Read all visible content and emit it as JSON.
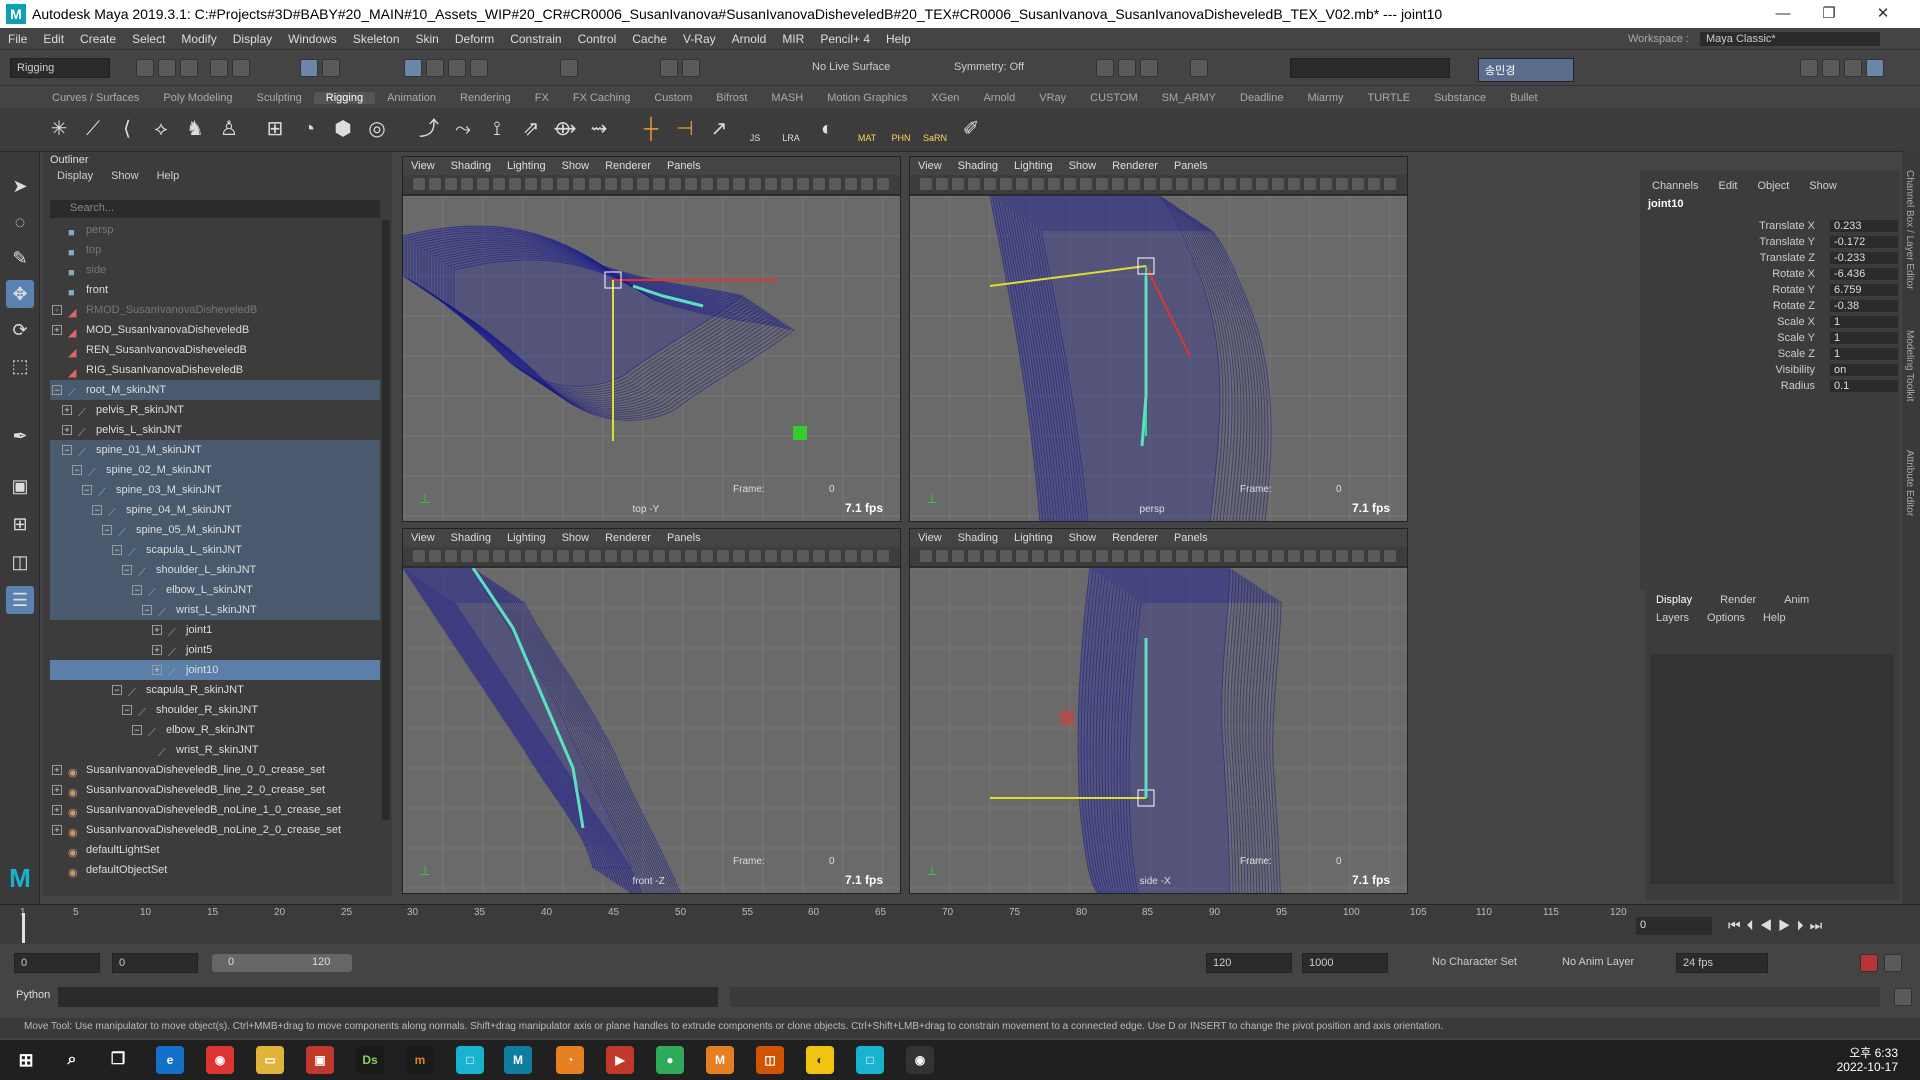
{
  "window": {
    "title": "Autodesk Maya 2019.3.1: C:#Projects#3D#BABY#20_MAIN#10_Assets_WIP#20_CR#CR0006_SusanIvanova#SusanIvanovaDisheveledB#20_TEX#CR0006_SusanIvanova_SusanIvanovaDisheveledB_TEX_V02.mb*  ---  joint10",
    "minimize": "—",
    "maximize": "❐",
    "close": "✕",
    "logo": "M"
  },
  "menubar": [
    "File",
    "Edit",
    "Create",
    "Select",
    "Modify",
    "Display",
    "Windows",
    "Skeleton",
    "Skin",
    "Deform",
    "Constrain",
    "Control",
    "Cache",
    "V-Ray",
    "Arnold",
    "MIR",
    "Pencil+ 4",
    "Help"
  ],
  "workspace": {
    "label": "Workspace :",
    "value": "Maya Classic*"
  },
  "statusline": {
    "menuset": "Rigging",
    "live_surface": "No Live Surface",
    "symmetry": "Symmetry: Off",
    "user": "송민경"
  },
  "shelf_tabs": [
    "Curves / Surfaces",
    "Poly Modeling",
    "Sculpting",
    "Rigging",
    "Animation",
    "Rendering",
    "FX",
    "FX Caching",
    "Custom",
    "Bifrost",
    "MASH",
    "Motion Graphics",
    "XGen",
    "Arnold",
    "VRay",
    "CUSTOM",
    "SM_ARMY",
    "Deadline",
    "Miarmy",
    "TURTLE",
    "Substance",
    "Bullet"
  ],
  "shelf_active": "Rigging",
  "shelf_labels": {
    "js": "JS",
    "lra": "LRA",
    "mat": "MAT",
    "phn": "PHN",
    "sarn": "SaRN"
  },
  "outliner": {
    "title": "Outliner",
    "menu": [
      "Display",
      "Show",
      "Help"
    ],
    "search_placeholder": "Search...",
    "items": [
      {
        "label": "persp",
        "indent": 0,
        "state": "dim",
        "icon": "camera"
      },
      {
        "label": "top",
        "indent": 0,
        "state": "dim",
        "icon": "camera"
      },
      {
        "label": "side",
        "indent": 0,
        "state": "dim",
        "icon": "camera"
      },
      {
        "label": "front",
        "indent": 0,
        "state": "",
        "icon": "camera"
      },
      {
        "label": "RMOD_SusanIvanovaDisheveledB",
        "indent": 0,
        "state": "dim",
        "icon": "mesh",
        "exp": "+"
      },
      {
        "label": "MOD_SusanIvanovaDisheveledB",
        "indent": 0,
        "state": "",
        "icon": "mesh",
        "exp": "+"
      },
      {
        "label": "REN_SusanIvanovaDisheveledB",
        "indent": 0,
        "state": "",
        "icon": "mesh"
      },
      {
        "label": "RIG_SusanIvanovaDisheveledB",
        "indent": 0,
        "state": "",
        "icon": "mesh"
      },
      {
        "label": "root_M_skinJNT",
        "indent": 0,
        "state": "hl",
        "icon": "joint",
        "exp": "−"
      },
      {
        "label": "pelvis_R_skinJNT",
        "indent": 1,
        "state": "",
        "icon": "joint",
        "exp": "+"
      },
      {
        "label": "pelvis_L_skinJNT",
        "indent": 1,
        "state": "",
        "icon": "joint",
        "exp": "+"
      },
      {
        "label": "spine_01_M_skinJNT",
        "indent": 1,
        "state": "hl",
        "icon": "joint",
        "exp": "−"
      },
      {
        "label": "spine_02_M_skinJNT",
        "indent": 2,
        "state": "hl",
        "icon": "joint",
        "exp": "−"
      },
      {
        "label": "spine_03_M_skinJNT",
        "indent": 3,
        "state": "hl",
        "icon": "joint",
        "exp": "−"
      },
      {
        "label": "spine_04_M_skinJNT",
        "indent": 4,
        "state": "hl",
        "icon": "joint",
        "exp": "−"
      },
      {
        "label": "spine_05_M_skinJNT",
        "indent": 5,
        "state": "hl",
        "icon": "joint",
        "exp": "−"
      },
      {
        "label": "scapula_L_skinJNT",
        "indent": 6,
        "state": "hl",
        "icon": "joint",
        "exp": "−"
      },
      {
        "label": "shoulder_L_skinJNT",
        "indent": 7,
        "state": "hl",
        "icon": "joint",
        "exp": "−"
      },
      {
        "label": "elbow_L_skinJNT",
        "indent": 8,
        "state": "hl",
        "icon": "joint",
        "exp": "−"
      },
      {
        "label": "wrist_L_skinJNT",
        "indent": 9,
        "state": "hl",
        "icon": "joint",
        "exp": "−"
      },
      {
        "label": "joint1",
        "indent": 10,
        "state": "",
        "icon": "joint",
        "exp": "+"
      },
      {
        "label": "joint5",
        "indent": 10,
        "state": "",
        "icon": "joint",
        "exp": "+"
      },
      {
        "label": "joint10",
        "indent": 10,
        "state": "sel",
        "icon": "joint",
        "exp": "+"
      },
      {
        "label": "scapula_R_skinJNT",
        "indent": 6,
        "state": "",
        "icon": "joint",
        "exp": "−"
      },
      {
        "label": "shoulder_R_skinJNT",
        "indent": 7,
        "state": "",
        "icon": "joint",
        "exp": "−"
      },
      {
        "label": "elbow_R_skinJNT",
        "indent": 8,
        "state": "",
        "icon": "joint",
        "exp": "−"
      },
      {
        "label": "wrist_R_skinJNT",
        "indent": 9,
        "state": "",
        "icon": "joint"
      },
      {
        "label": "SusanIvanovaDisheveledB_line_0_0_crease_set",
        "indent": 0,
        "state": "",
        "icon": "set",
        "exp": "+"
      },
      {
        "label": "SusanIvanovaDisheveledB_line_2_0_crease_set",
        "indent": 0,
        "state": "",
        "icon": "set",
        "exp": "+"
      },
      {
        "label": "SusanIvanovaDisheveledB_noLine_1_0_crease_set",
        "indent": 0,
        "state": "",
        "icon": "set",
        "exp": "+"
      },
      {
        "label": "SusanIvanovaDisheveledB_noLine_2_0_crease_set",
        "indent": 0,
        "state": "",
        "icon": "set",
        "exp": "+"
      },
      {
        "label": "defaultLightSet",
        "indent": 0,
        "state": "",
        "icon": "set"
      },
      {
        "label": "defaultObjectSet",
        "indent": 0,
        "state": "",
        "icon": "set"
      }
    ]
  },
  "viewport": {
    "menu": [
      "View",
      "Shading",
      "Lighting",
      "Show",
      "Renderer",
      "Panels"
    ],
    "frame_label": "Frame:",
    "frame_value": "0",
    "fps": "7.1 fps",
    "panes": [
      {
        "camera": "top -Y"
      },
      {
        "camera": "persp"
      },
      {
        "camera": "front -Z"
      },
      {
        "camera": "side -X"
      }
    ]
  },
  "channelbox": {
    "menu": [
      "Channels",
      "Edit",
      "Object",
      "Show"
    ],
    "object": "joint10",
    "attrs": [
      {
        "label": "Translate X",
        "value": "0.233"
      },
      {
        "label": "Translate Y",
        "value": "-0.172"
      },
      {
        "label": "Translate Z",
        "value": "-0.233"
      },
      {
        "label": "Rotate X",
        "value": "-6.436"
      },
      {
        "label": "Rotate Y",
        "value": "6.759"
      },
      {
        "label": "Rotate Z",
        "value": "-0.38"
      },
      {
        "label": "Scale X",
        "value": "1"
      },
      {
        "label": "Scale Y",
        "value": "1"
      },
      {
        "label": "Scale Z",
        "value": "1"
      },
      {
        "label": "Visibility",
        "value": "on"
      },
      {
        "label": "Radius",
        "value": "0.1"
      }
    ]
  },
  "layereditor": {
    "tabs": [
      "Display",
      "Render",
      "Anim"
    ],
    "menu": [
      "Layers",
      "Options",
      "Help"
    ]
  },
  "sidetabs": [
    "Channel Box / Layer Editor",
    "Modeling Toolkit",
    "Attribute Editor"
  ],
  "timeline": {
    "ticks": [
      "1",
      "5",
      "10",
      "15",
      "20",
      "25",
      "30",
      "35",
      "40",
      "45",
      "50",
      "55",
      "60",
      "65",
      "70",
      "75",
      "80",
      "85",
      "90",
      "95",
      "100",
      "105",
      "110",
      "115",
      "120"
    ],
    "current": "0"
  },
  "range": {
    "start": "0",
    "start2": "0",
    "slider_start": "0",
    "slider_end": "120",
    "end": "120",
    "end2": "1000",
    "character_set": "No Character Set",
    "anim_layer": "No Anim Layer",
    "fps": "24 fps"
  },
  "cmdline": {
    "label": "Python"
  },
  "helpline": "Move Tool: Use manipulator to move object(s). Ctrl+MMB+drag to move components along normals. Shift+drag manipulator axis or plane handles to extrude components or clone objects. Ctrl+Shift+LMB+drag to constrain movement to a connected edge. Use D or INSERT to change the pivot position and axis orientation.",
  "taskbar": {
    "time": "오후 6:33",
    "date": "2022-10-17"
  }
}
